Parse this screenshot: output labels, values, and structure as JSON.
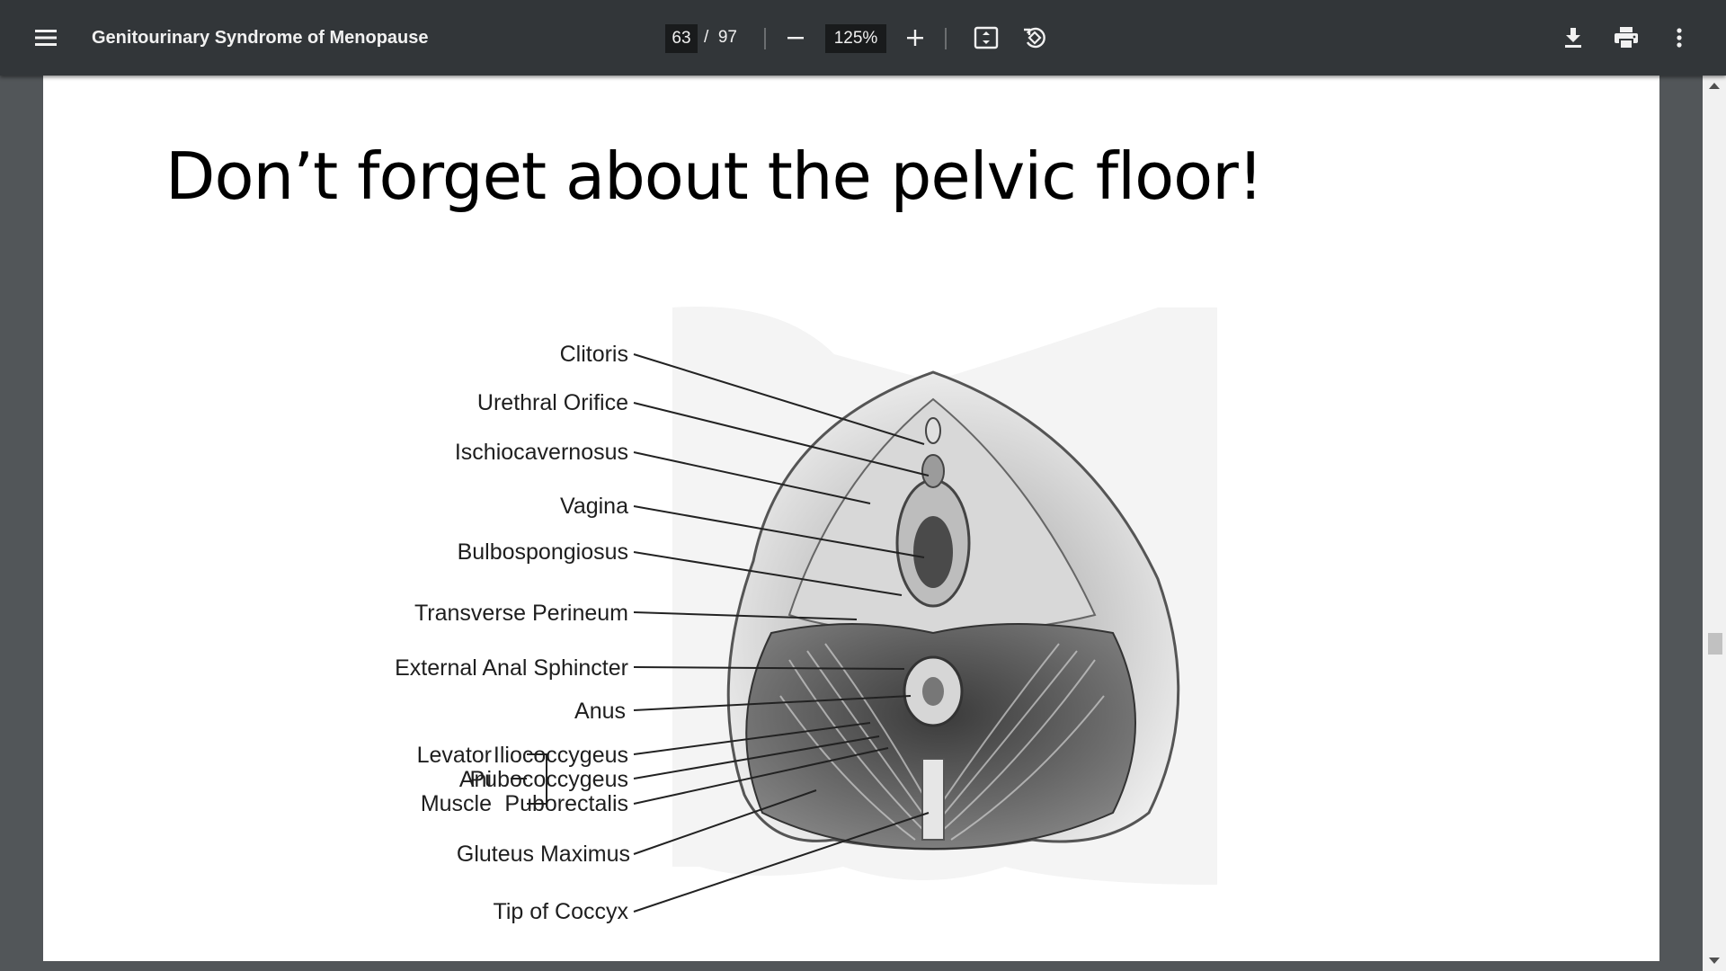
{
  "toolbar": {
    "menu_icon": "hamburger-menu-icon",
    "title": "Genitourinary Syndrome of Menopause",
    "page_current": "63",
    "page_separator": "/",
    "page_total": "97",
    "zoom_value": "125%",
    "icons": [
      "zoom-out-icon",
      "zoom-in-icon",
      "fit-to-page-icon",
      "rotate-icon",
      "download-icon",
      "print-icon",
      "more-options-icon"
    ]
  },
  "slide": {
    "title": "Don’t forget about the pelvic floor!",
    "labels": {
      "clitoris": "Clitoris",
      "urethral_orifice": "Urethral Orifice",
      "ischiocavernosus": "Ischiocavernosus",
      "vagina": "Vagina",
      "bulbospongiosus": "Bulbospongiosus",
      "transverse_perineum": "Transverse Perineum",
      "external_anal_sphincter": "External Anal Sphincter",
      "anus": "Anus",
      "levator": "Levator",
      "ani": "Ani",
      "muscle": "Muscle",
      "iliococcygeus": "Iliococcygeus",
      "pubococcygeus": "Pubococcygeus",
      "puborectalis": "Puborectalis",
      "gluteus_maximus": "Gluteus Maximus",
      "tip_of_coccyx": "Tip of Coccyx"
    }
  },
  "colors": {
    "toolbar_bg": "#323639",
    "viewer_bg": "#525659",
    "page_bg": "#ffffff"
  }
}
